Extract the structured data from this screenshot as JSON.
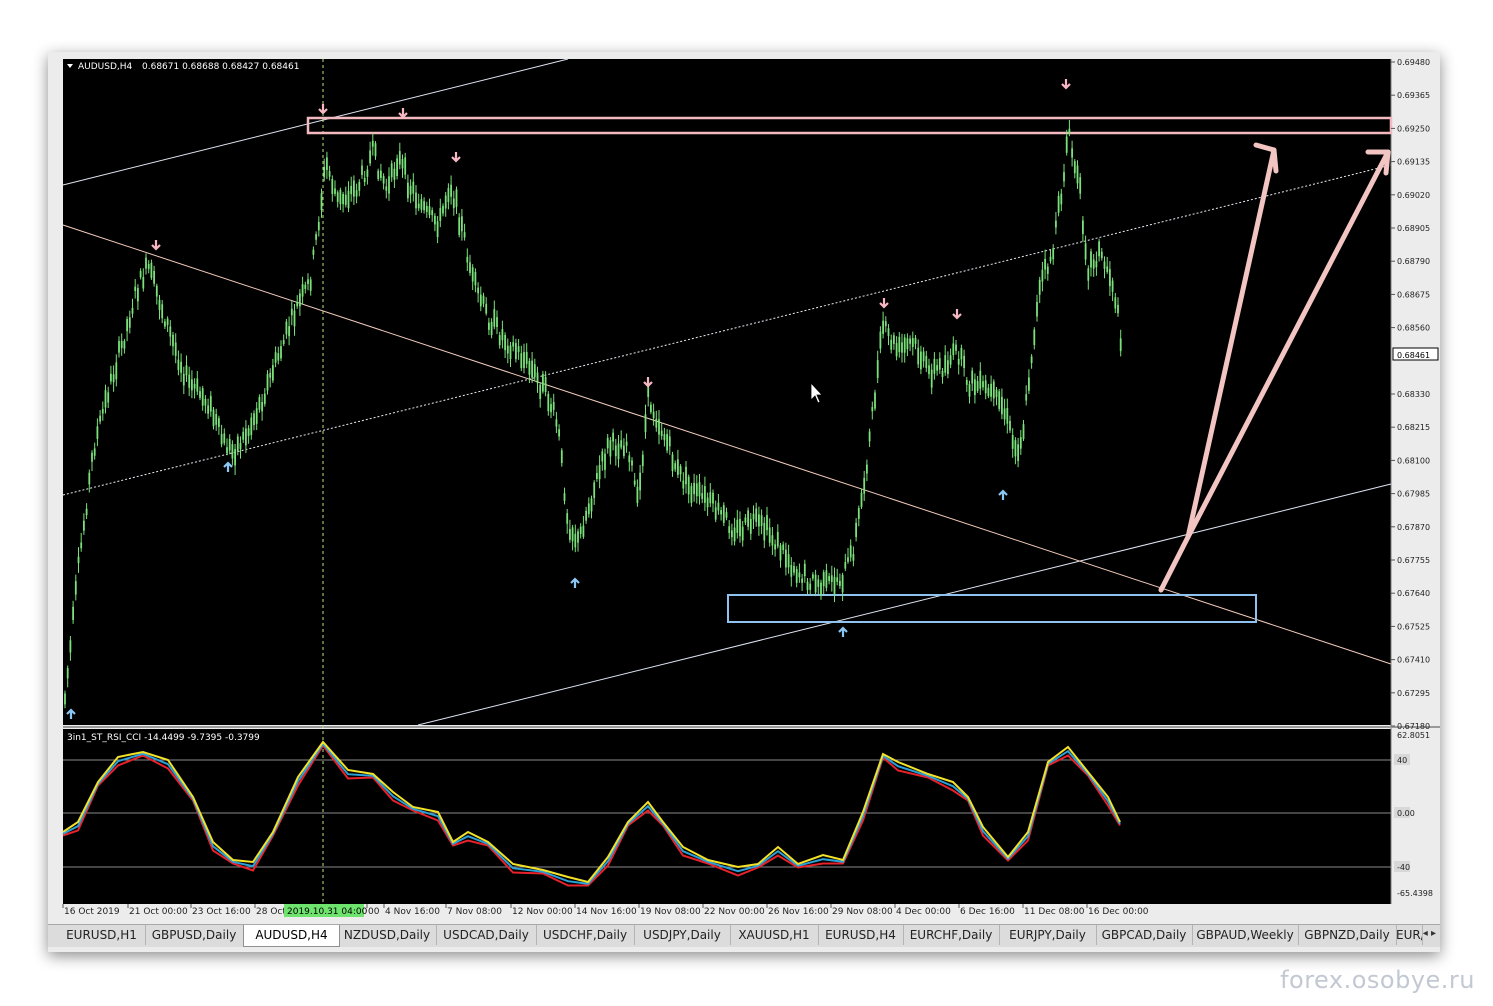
{
  "chart_header": {
    "symbol_text": "AUDUSD,H4",
    "ohlc_text": "0.68671 0.68688 0.68427 0.68461"
  },
  "current_price_label": "0.68461",
  "crosshair_time_label": "2019.10.31 04:00",
  "price_axis_labels": [
    "0.69480",
    "0.69365",
    "0.69250",
    "0.69135",
    "0.69020",
    "0.68905",
    "0.68790",
    "0.68675",
    "0.68560",
    "0.68330",
    "0.68215",
    "0.68100",
    "0.67985",
    "0.67870",
    "0.67755",
    "0.67640",
    "0.67525",
    "0.67410",
    "0.67295",
    "0.67180"
  ],
  "indicator": {
    "label": "3in1_ST_RSI_CCI -14.4499 -9.7395 -0.3799",
    "axis_labels": [
      "62.8051",
      "40",
      "0.00",
      "-40",
      "-65.4398"
    ]
  },
  "time_axis_labels": [
    "16 Oct 2019",
    "21 Oct 00:00",
    "23 Oct 16:00",
    "28 Oct",
    "00",
    "4 Nov 16:00",
    "7 Nov 08:00",
    "12 Nov 00:00",
    "14 Nov 16:00",
    "19 Nov 08:00",
    "22 Nov 00:00",
    "26 Nov 16:00",
    "29 Nov 08:00",
    "4 Dec 00:00",
    "6 Dec 16:00",
    "11 Dec 08:00",
    "16 Dec 00:00"
  ],
  "tabs": [
    {
      "label": "EURUSD,H1",
      "active": false
    },
    {
      "label": "GBPUSD,Daily",
      "active": false
    },
    {
      "label": "AUDUSD,H4",
      "active": true
    },
    {
      "label": "NZDUSD,Daily",
      "active": false
    },
    {
      "label": "USDCAD,Daily",
      "active": false
    },
    {
      "label": "USDCHF,Daily",
      "active": false
    },
    {
      "label": "USDJPY,Daily",
      "active": false
    },
    {
      "label": "XAUUSD,H1",
      "active": false
    },
    {
      "label": "EURUSD,H4",
      "active": false
    },
    {
      "label": "EURCHF,Daily",
      "active": false
    },
    {
      "label": "EURJPY,Daily",
      "active": false
    },
    {
      "label": "GBPCAD,Daily",
      "active": false
    },
    {
      "label": "GBPAUD,Weekly",
      "active": false
    },
    {
      "label": "GBPNZD,Daily",
      "active": false
    },
    {
      "label": "EUR/",
      "active": false
    }
  ],
  "tab_scroll_label": "◂ ▸",
  "watermark": "forex.osobye.ru",
  "colors": {
    "background": "#000000",
    "candles": "#7be27b",
    "resistance_zone": "#f4b8c0",
    "support_zone": "#8fc2ee",
    "sell_arrow": "#f7b8c4",
    "buy_arrow": "#8cc6f2",
    "channel_line": "#dde4f2",
    "descending_line": "#f2cdbc",
    "forecast_arrow": "#f2c4c2",
    "indicator_red": "#e8222a",
    "indicator_blue": "#2aa0d8",
    "indicator_yellow": "#f2e22a",
    "crosshair": "#b9e67a"
  }
}
